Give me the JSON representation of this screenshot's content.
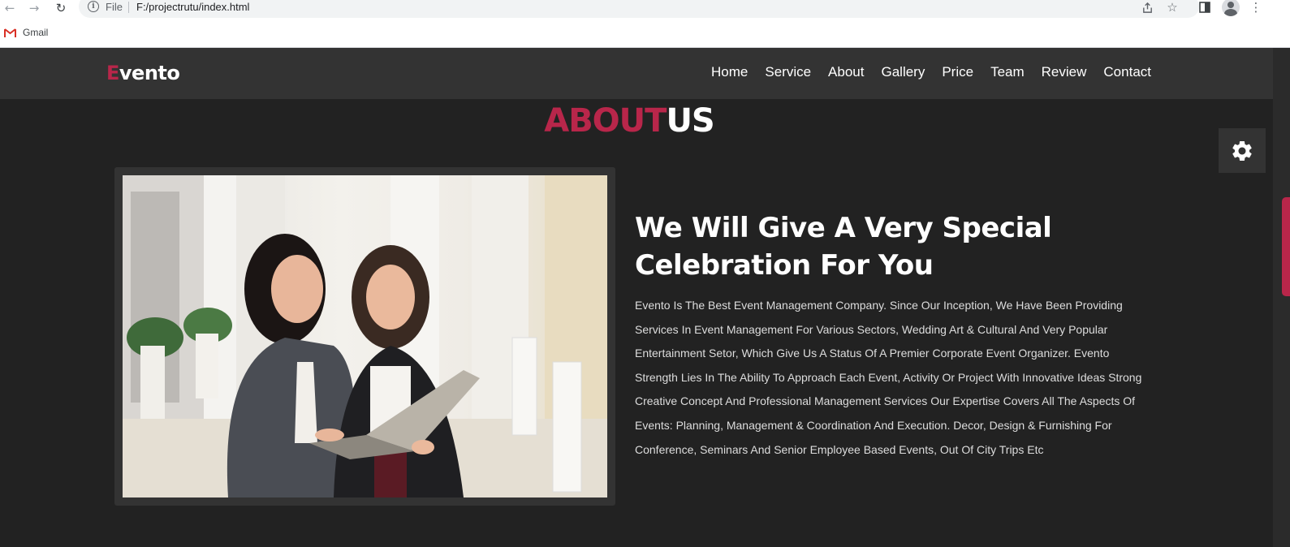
{
  "browser": {
    "file_label": "File",
    "url": "F:/projectrutu/index.html",
    "bookmarks": [
      {
        "label": "Gmail"
      }
    ]
  },
  "site": {
    "logo": {
      "first_letter": "E",
      "rest": "vento"
    },
    "nav": [
      "Home",
      "Service",
      "About",
      "Gallery",
      "Price",
      "Team",
      "Review",
      "Contact"
    ],
    "accent_color": "#b8264a"
  },
  "about": {
    "title_part1": "ABOUT",
    "title_part2": "US",
    "heading": "We Will Give A Very Special Celebration For You",
    "paragraph": "Evento Is The Best Event Management Company. Since Our Inception, We Have Been Providing Services In Event Management For Various Sectors, Wedding Art & Cultural And Very Popular Entertainment Setor, Which Give Us A Status Of A Premier Corporate Event Organizer. Evento Strength Lies In The Ability To Approach Each Event, Activity Or Project With Innovative Ideas Strong Creative Concept And Professional Management Services Our Expertise Covers All The Aspects Of Events: Planning, Management & Coordination And Execution. Decor, Design & Furnishing For Conference, Seminars And Senior Employee Based Events, Out Of City Trips Etc"
  },
  "icons": [
    "back-arrow-icon",
    "forward-arrow-icon",
    "reload-icon",
    "info-icon",
    "share-icon",
    "star-icon",
    "side-panel-icon",
    "profile-icon",
    "menu-dots-icon",
    "gmail-icon",
    "gear-icon"
  ]
}
